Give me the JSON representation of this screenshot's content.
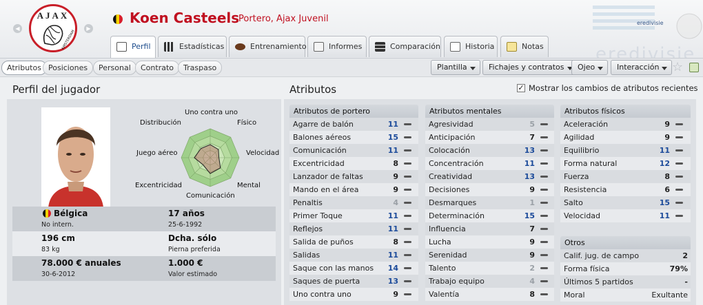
{
  "player": {
    "name": "Koen Casteels",
    "position_club": "Portero, Ajax Juvenil"
  },
  "club_logo_text": "AJAX",
  "club_logo_subtext": "AMSTERDAM",
  "watermark_text": "eredivisie",
  "tabs": [
    {
      "label": "Perfil",
      "icon": "profile-icon",
      "active": true
    },
    {
      "label": "Estadísticas",
      "icon": "bar-chart-icon"
    },
    {
      "label": "Entrenamiento",
      "icon": "ball-icon"
    },
    {
      "label": "Informes",
      "icon": "report-icon"
    },
    {
      "label": "Comparación",
      "icon": "compare-icon"
    },
    {
      "label": "Historia",
      "icon": "history-icon"
    },
    {
      "label": "Notas",
      "icon": "notes-icon"
    }
  ],
  "subtabs": [
    "Atributos",
    "Posiciones",
    "Personal",
    "Contrato",
    "Traspaso"
  ],
  "menus": [
    "Plantilla",
    "Fichajes y contratos",
    "Ojeo",
    "Interacción"
  ],
  "profile": {
    "title": "Perfil del jugador",
    "radar_labels": [
      "Uno contra uno",
      "Físico",
      "Velocidad",
      "Mental",
      "Comunicación",
      "Excentricidad",
      "Juego aéreo",
      "Distribución"
    ],
    "radar_values": [
      0.45,
      0.4,
      0.3,
      0.5,
      0.55,
      0.35,
      0.55,
      0.45
    ],
    "nation": "Bélgica",
    "caps": "No intern.",
    "age": "17 años",
    "dob": "25-6-1992",
    "height": "196 cm",
    "weight": "83 kg",
    "foot": "Dcha. sólo",
    "foot_label": "Pierna preferida",
    "wage": "78.000 € anuales",
    "contract_end": "30-6-2012",
    "value": "1.000 €",
    "value_label": "Valor estimado"
  },
  "attributes": {
    "title": "Atributos",
    "show_changes_label": "Mostrar los cambios de atributos recientes",
    "goalkeeper": {
      "title": "Atributos de portero",
      "rows": [
        {
          "name": "Agarre de balón",
          "value": "11"
        },
        {
          "name": "Balones aéreos",
          "value": "15"
        },
        {
          "name": "Comunicación",
          "value": "11"
        },
        {
          "name": "Excentricidad",
          "value": "8"
        },
        {
          "name": "Lanzador de faltas",
          "value": "9"
        },
        {
          "name": "Mando en el área",
          "value": "9"
        },
        {
          "name": "Penaltis",
          "value": "4"
        },
        {
          "name": "Primer Toque",
          "value": "11"
        },
        {
          "name": "Reflejos",
          "value": "11"
        },
        {
          "name": "Salida de puños",
          "value": "8"
        },
        {
          "name": "Salidas",
          "value": "11"
        },
        {
          "name": "Saque con las manos",
          "value": "14"
        },
        {
          "name": "Saques de puerta",
          "value": "13"
        },
        {
          "name": "Uno contra uno",
          "value": "9"
        }
      ]
    },
    "mental": {
      "title": "Atributos mentales",
      "rows": [
        {
          "name": "Agresividad",
          "value": "5"
        },
        {
          "name": "Anticipación",
          "value": "7"
        },
        {
          "name": "Colocación",
          "value": "13"
        },
        {
          "name": "Concentración",
          "value": "11"
        },
        {
          "name": "Creatividad",
          "value": "13"
        },
        {
          "name": "Decisiones",
          "value": "9"
        },
        {
          "name": "Desmarques",
          "value": "1"
        },
        {
          "name": "Determinación",
          "value": "15"
        },
        {
          "name": "Influencia",
          "value": "7"
        },
        {
          "name": "Lucha",
          "value": "9"
        },
        {
          "name": "Serenidad",
          "value": "9"
        },
        {
          "name": "Talento",
          "value": "2"
        },
        {
          "name": "Trabajo equipo",
          "value": "4"
        },
        {
          "name": "Valentía",
          "value": "8"
        }
      ]
    },
    "physical": {
      "title": "Atributos físicos",
      "rows": [
        {
          "name": "Aceleración",
          "value": "9"
        },
        {
          "name": "Agilidad",
          "value": "9"
        },
        {
          "name": "Equilibrio",
          "value": "11"
        },
        {
          "name": "Forma natural",
          "value": "12"
        },
        {
          "name": "Fuerza",
          "value": "8"
        },
        {
          "name": "Resistencia",
          "value": "6"
        },
        {
          "name": "Salto",
          "value": "15"
        },
        {
          "name": "Velocidad",
          "value": "11"
        }
      ]
    },
    "otros": {
      "title": "Otros",
      "rows": [
        {
          "name": "Calif. jug. de campo",
          "value": "2"
        },
        {
          "name": "Forma física",
          "value": "79%"
        },
        {
          "name": "Últimos 5 partidos",
          "value": "-"
        },
        {
          "name": "Moral",
          "value": "Exultante"
        }
      ]
    }
  },
  "colors": {
    "accent_red": "#c01020",
    "high_value": "#1b4a9a",
    "low_value": "#9aa0a6"
  }
}
